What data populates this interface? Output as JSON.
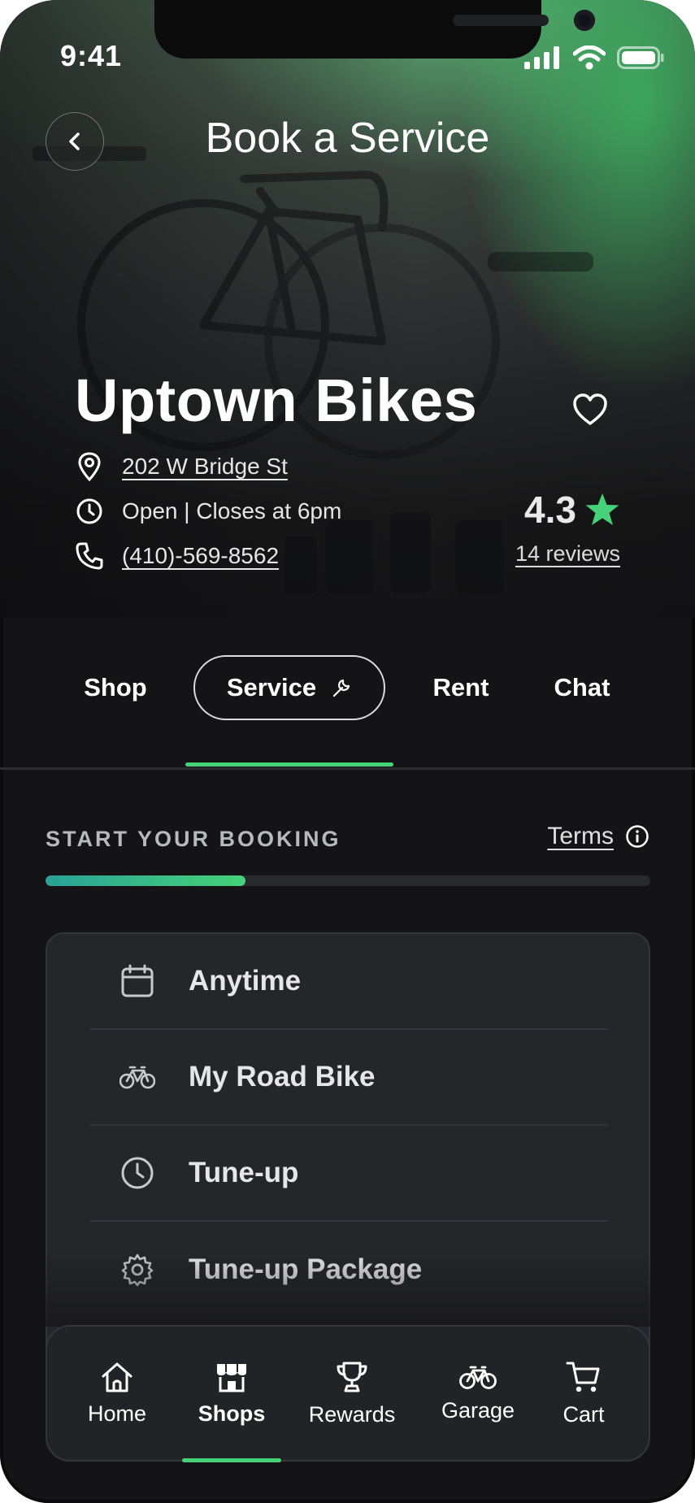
{
  "status_bar": {
    "time": "9:41"
  },
  "header": {
    "title": "Book a Service"
  },
  "shop": {
    "name": "Uptown Bikes",
    "address": "202 W Bridge St",
    "hours": "Open | Closes at 6pm",
    "phone": "(410)-569-8562",
    "rating": "4.3",
    "reviews": "14 reviews"
  },
  "tabs": [
    {
      "label": "Shop"
    },
    {
      "label": "Service",
      "active": true
    },
    {
      "label": "Rent"
    },
    {
      "label": "Chat"
    }
  ],
  "booking": {
    "section_label": "START YOUR BOOKING",
    "terms_label": "Terms",
    "progress": 0.33,
    "items": [
      {
        "label": "Anytime",
        "icon": "calendar-icon"
      },
      {
        "label": "My Road Bike",
        "icon": "bicycle-icon"
      },
      {
        "label": "Tune-up",
        "icon": "clock-icon"
      },
      {
        "label": "Tune-up Package",
        "icon": "gear-icon"
      }
    ]
  },
  "nav": [
    {
      "label": "Home",
      "icon": "home-icon"
    },
    {
      "label": "Shops",
      "icon": "storefront-icon",
      "active": true
    },
    {
      "label": "Rewards",
      "icon": "trophy-icon"
    },
    {
      "label": "Garage",
      "icon": "bicycle-icon"
    },
    {
      "label": "Cart",
      "icon": "cart-icon"
    }
  ],
  "colors": {
    "accent": "#46d278",
    "background": "#141416",
    "card": "#25262a",
    "star": "#46d278"
  }
}
